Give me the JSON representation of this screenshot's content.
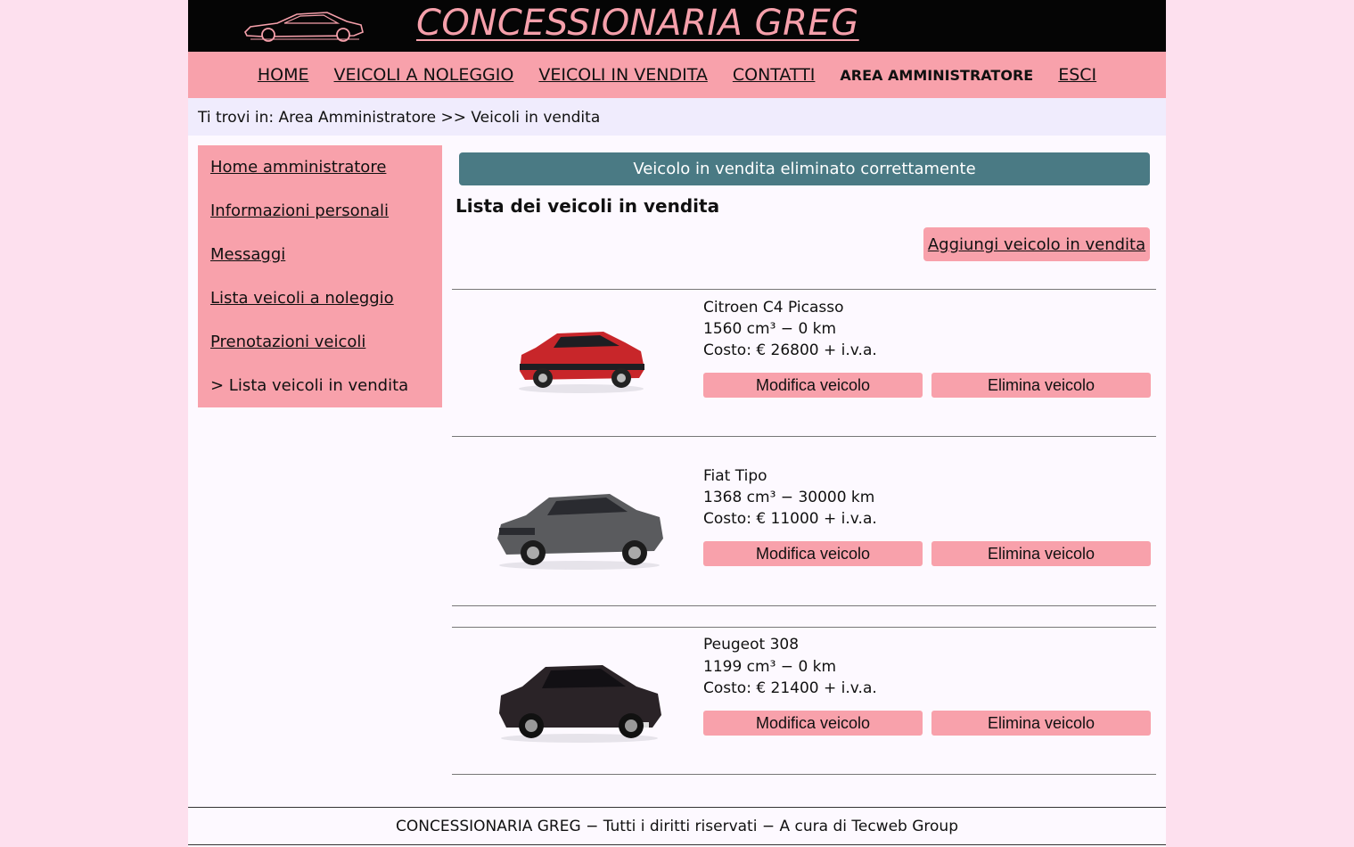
{
  "header": {
    "title": "CONCESSIONARIA GREG",
    "logo_icon": "car-silhouette-icon"
  },
  "nav": {
    "items": [
      "HOME",
      "VEICOLI A NOLEGGIO",
      "VEICOLI IN VENDITA",
      "CONTATTI",
      "AREA AMMINISTRATORE",
      "ESCI"
    ],
    "current": "AREA AMMINISTRATORE"
  },
  "breadcrumb": "Ti trovi in: Area Amministratore >> Veicoli in vendita",
  "sidebar": {
    "items": [
      "Home amministratore",
      "Informazioni personali",
      "Messaggi",
      "Lista veicoli a noleggio",
      "Prenotazioni veicoli",
      "> Lista veicoli in vendita"
    ]
  },
  "alert": "Veicolo in vendita eliminato correttamente",
  "list_title": "Lista dei veicoli in vendita",
  "add_button": "Aggiungi veicolo in vendita",
  "vehicles": [
    {
      "name": "Citroen C4 Picasso",
      "spec": "1560 cm³ − 0 km",
      "cost": "Costo: € 26800 + i.v.a.",
      "color": "#c8262a"
    },
    {
      "name": "Fiat Tipo",
      "spec": "1368 cm³ − 30000 km",
      "cost": "Costo: € 11000 + i.v.a.",
      "color": "#5a5b5e"
    },
    {
      "name": "Peugeot 308",
      "spec": "1199 cm³ − 0 km",
      "cost": "Costo: € 21400 + i.v.a.",
      "color": "#2a2327"
    }
  ],
  "buttons": {
    "edit": "Modifica veicolo",
    "delete": "Elimina veicolo"
  },
  "footer": "CONCESSIONARIA GREG − Tutti i diritti riservati − A cura di Tecweb Group",
  "colors": {
    "background": "#fde0ee",
    "header_bg": "#050505",
    "accent_pink": "#f8a1ab",
    "alert_bg": "#4a7a84",
    "breadcrumb_bg": "#f0ecfd"
  }
}
